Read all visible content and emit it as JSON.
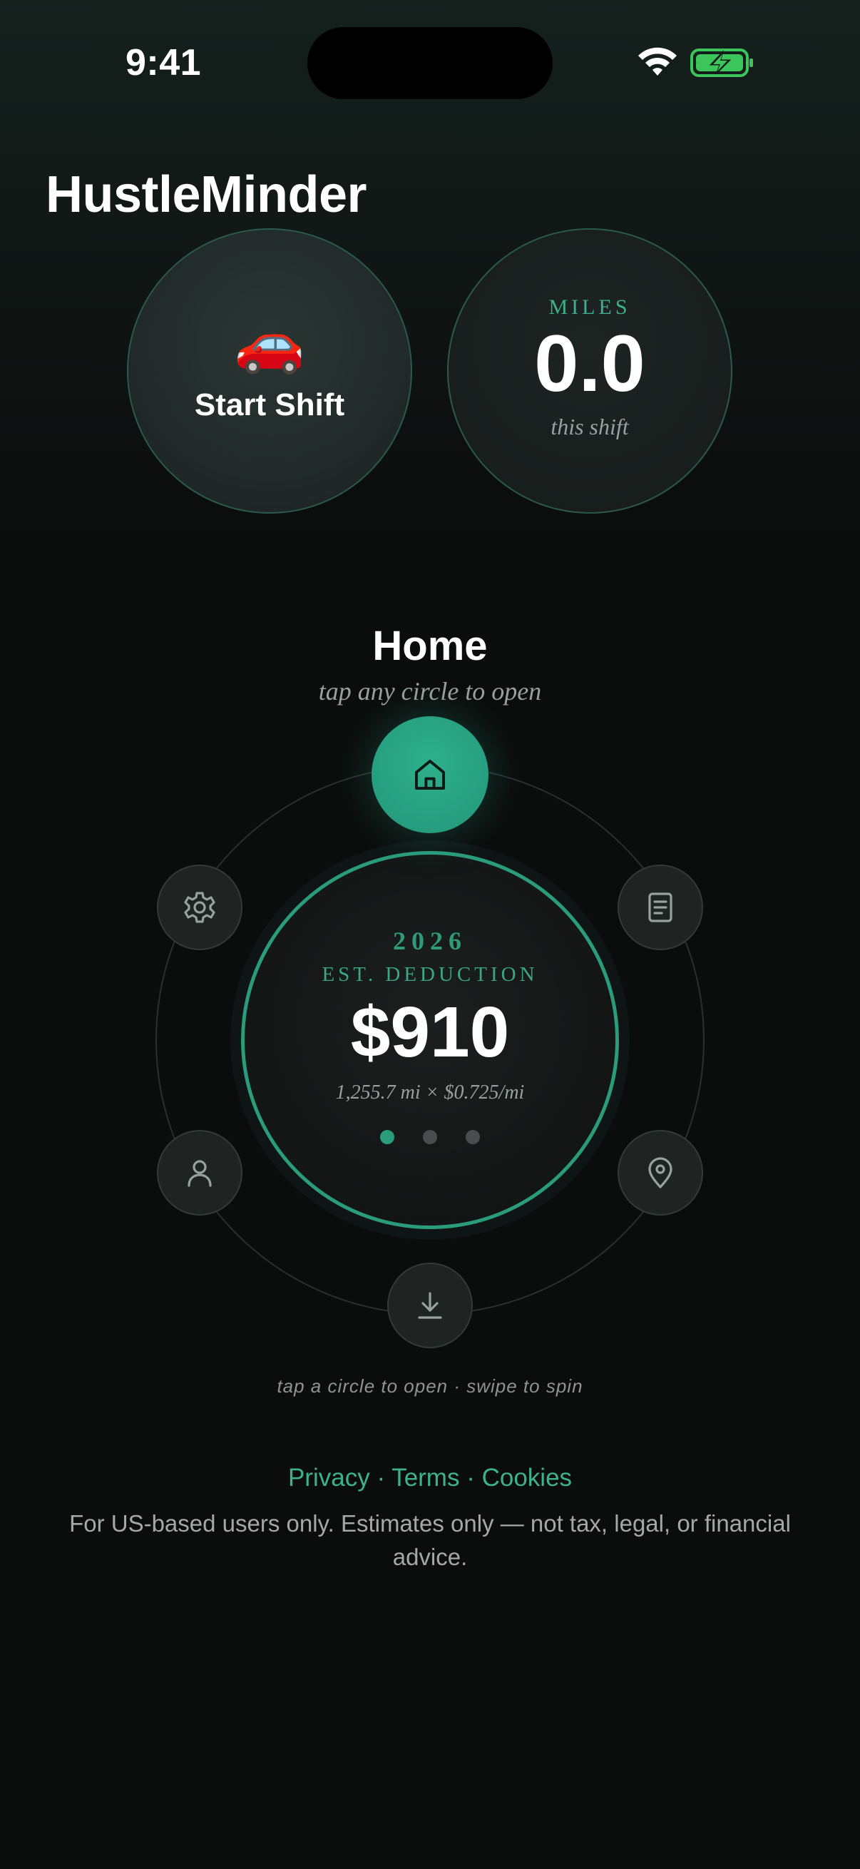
{
  "status_bar": {
    "time": "9:41",
    "wifi_icon": "wifi-icon",
    "battery_icon": "battery-charging-icon",
    "battery_color": "#3cc55a"
  },
  "app": {
    "title": "HustleMinder"
  },
  "shift": {
    "icon": "🚗",
    "start_label": "Start Shift"
  },
  "miles": {
    "label": "MILES",
    "value": "0.0",
    "sub": "this shift"
  },
  "section": {
    "title": "Home",
    "subtitle": "tap any circle to open"
  },
  "dial": {
    "year": "2026",
    "label": "EST. DEDUCTION",
    "amount": "$910",
    "formula": "1,255.7 mi × $0.725/mi",
    "page_count": 3,
    "active_page": 1
  },
  "wheel_nodes": [
    {
      "name": "home",
      "icon": "home-icon",
      "active": true
    },
    {
      "name": "documents",
      "icon": "document-icon"
    },
    {
      "name": "locations",
      "icon": "map-pin-icon"
    },
    {
      "name": "export",
      "icon": "download-icon"
    },
    {
      "name": "profile",
      "icon": "person-icon"
    },
    {
      "name": "settings",
      "icon": "gear-icon"
    }
  ],
  "hint": "tap a circle to open · swipe to spin",
  "footer": {
    "links": [
      "Privacy",
      "Terms",
      "Cookies"
    ],
    "separator": "·",
    "disclaimer": "For US-based users only. Estimates only — not tax, legal, or financial advice."
  },
  "colors": {
    "accent": "#2a9c7b",
    "accent_text": "#3cb28c",
    "background": "#0b0c0c"
  }
}
